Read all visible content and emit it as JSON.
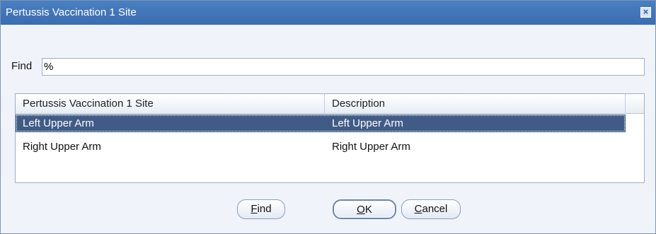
{
  "dialog": {
    "title": "Pertussis Vaccination 1 Site"
  },
  "icons": {
    "close": "close-icon"
  },
  "find": {
    "label": "Find",
    "value": "%"
  },
  "table": {
    "columns": [
      "Pertussis Vaccination 1 Site",
      "Description"
    ],
    "rows": [
      {
        "site": "Left Upper Arm",
        "description": "Left Upper Arm",
        "selected": true
      },
      {
        "site": "Right Upper Arm",
        "description": "Right Upper Arm",
        "selected": false
      }
    ]
  },
  "buttons": {
    "find": {
      "mnemonic": "F",
      "rest": "ind"
    },
    "ok": {
      "mnemonic": "O",
      "rest": "K"
    },
    "cancel": {
      "mnemonic": "C",
      "rest": "ancel"
    }
  },
  "colors": {
    "titlebar": "#3a6db0",
    "selection": "#405c86",
    "background": "#f0f4fa"
  }
}
